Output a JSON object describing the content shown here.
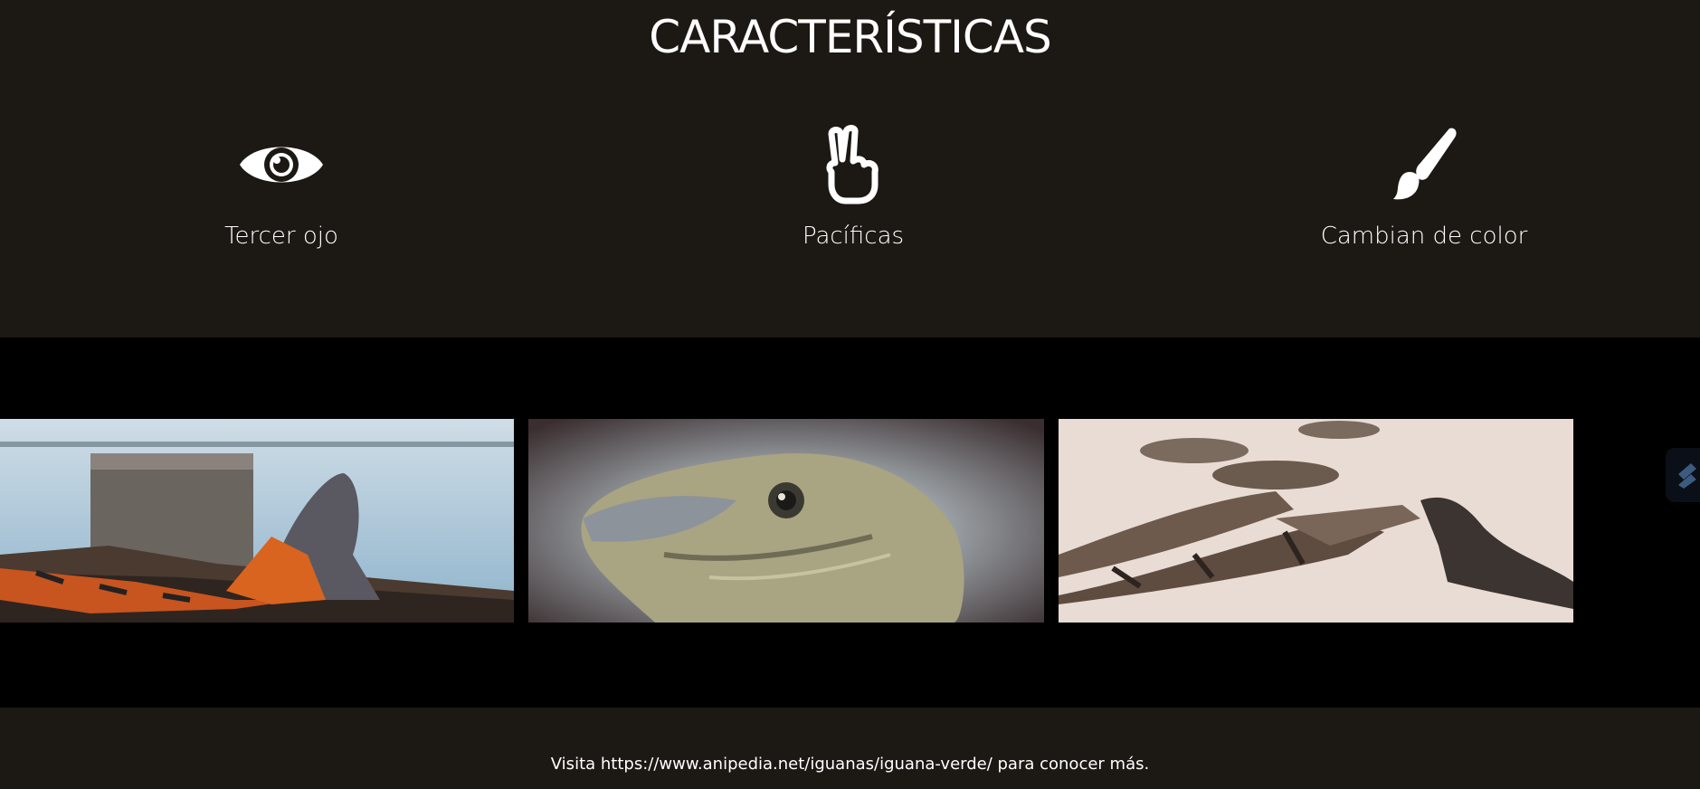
{
  "features": {
    "title": "CARACTERÍSTICAS",
    "items": [
      {
        "icon": "eye-icon",
        "label": "Tercer ojo"
      },
      {
        "icon": "hand-peace-icon",
        "label": "Pacíficas"
      },
      {
        "icon": "paint-brush-icon",
        "label": "Cambian de color"
      }
    ]
  },
  "gallery": {
    "images": [
      {
        "description_icon": "iguana-shore-image"
      },
      {
        "description_icon": "iguana-head-closeup-image"
      },
      {
        "description_icon": "iguanas-beach-group-image"
      }
    ],
    "next_icon": "next-arrow-icon"
  },
  "footer": {
    "text": "Visita https://www.anipedia.net/iguanas/iguana-verde/ para conocer más."
  },
  "colors": {
    "section_bg": "#1c1814",
    "gallery_bg": "#000000",
    "text": "#ffffff"
  }
}
